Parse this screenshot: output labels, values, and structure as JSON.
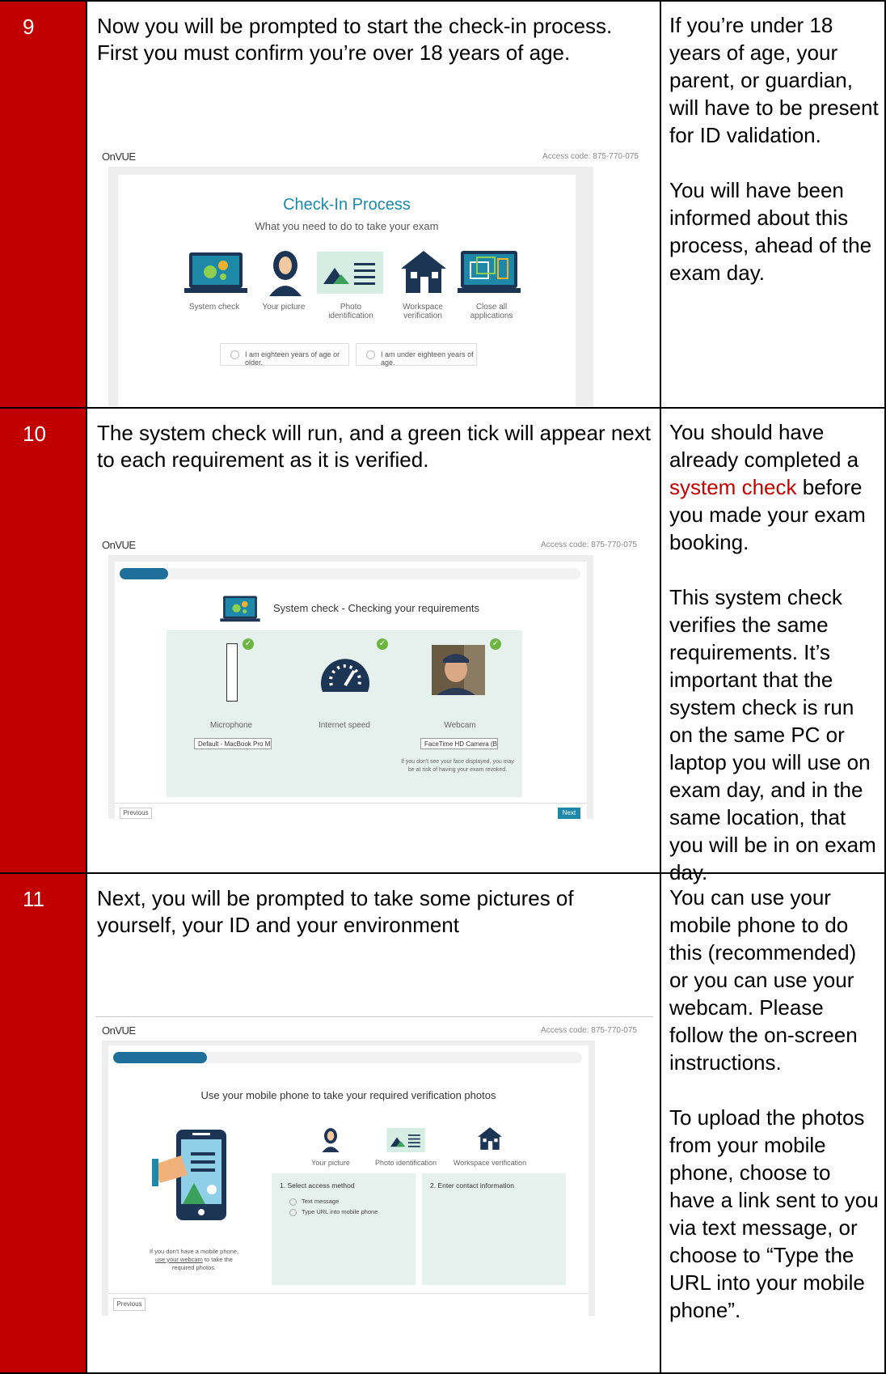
{
  "rows": [
    {
      "number": "9",
      "description": "Now you will be prompted to start the check-in process. First you must confirm you’re over 18 years of age.",
      "notes": [
        "If you’re under 18 years of age, your parent, or guardian, will have to be present for ID validation.",
        "You will have been informed about this process, ahead of the exam day."
      ],
      "screenshot": {
        "logo": "OnVUE",
        "access_code": "Access code: 875-770-075",
        "title": "Check-In Process",
        "subtitle": "What you need to do to take your exam",
        "steps": [
          "System check",
          "Your picture",
          "Photo identification",
          "Workspace verification",
          "Close all applications"
        ],
        "radio_older": "I am eighteen years of age or older.",
        "radio_under": "I am under eighteen years of age."
      }
    },
    {
      "number": "10",
      "description": "The system check will run, and a green tick will appear next to each requirement as it is verified.",
      "notes_prefix": "You should have already completed a",
      "notes_link": "system check",
      "notes_suffix": "before you made your exam booking.",
      "notes2": "This system check verifies the same requirements. It’s important that the system check is run on the same PC or laptop you will use on exam day, and in the same location, that you will be in on exam day.",
      "screenshot": {
        "logo": "OnVUE",
        "access_code": "Access code: 875-770-075",
        "progress": 0.1,
        "heading": "System check - Checking your requirements",
        "items": [
          "Microphone",
          "Internet speed",
          "Webcam"
        ],
        "mic_select": "Default - MacBook Pro M ↕",
        "cam_select": "FaceTime HD Camera (Bt ↕",
        "cam_warning": "If you don't see your face displayed, you may be at risk of having your exam revoked.",
        "previous": "Previous",
        "next": "Next"
      }
    },
    {
      "number": "11",
      "description": "Next, you will be prompted to take some pictures of yourself, your ID and your environment",
      "notes": [
        "You can use your mobile phone to do this (recommended) or you can use your webcam. Please follow the on-screen instructions.",
        "To upload the photos from your mobile phone, choose to have a link sent to you via text message, or choose to “Type the URL into your mobile phone”."
      ],
      "screenshot": {
        "logo": "OnVUE",
        "access_code": "Access code: 875-770-075",
        "progress": 0.2,
        "heading": "Use your mobile phone to take your required verification photos",
        "steps": [
          "Your picture",
          "Photo identification",
          "Workspace verification"
        ],
        "panel1_title": "1. Select access method",
        "option1": "Text message",
        "option2": "Type URL into mobile phone",
        "panel2_title": "2. Enter contact information",
        "no_phone_prefix": "If you don't have a mobile phone,",
        "no_phone_link": "use your webcam",
        "no_phone_suffix": "to take the required photos.",
        "previous": "Previous"
      }
    }
  ],
  "colors": {
    "number_bg": "#c00000",
    "teal": "#1e88a8",
    "link_red": "#c00000"
  }
}
